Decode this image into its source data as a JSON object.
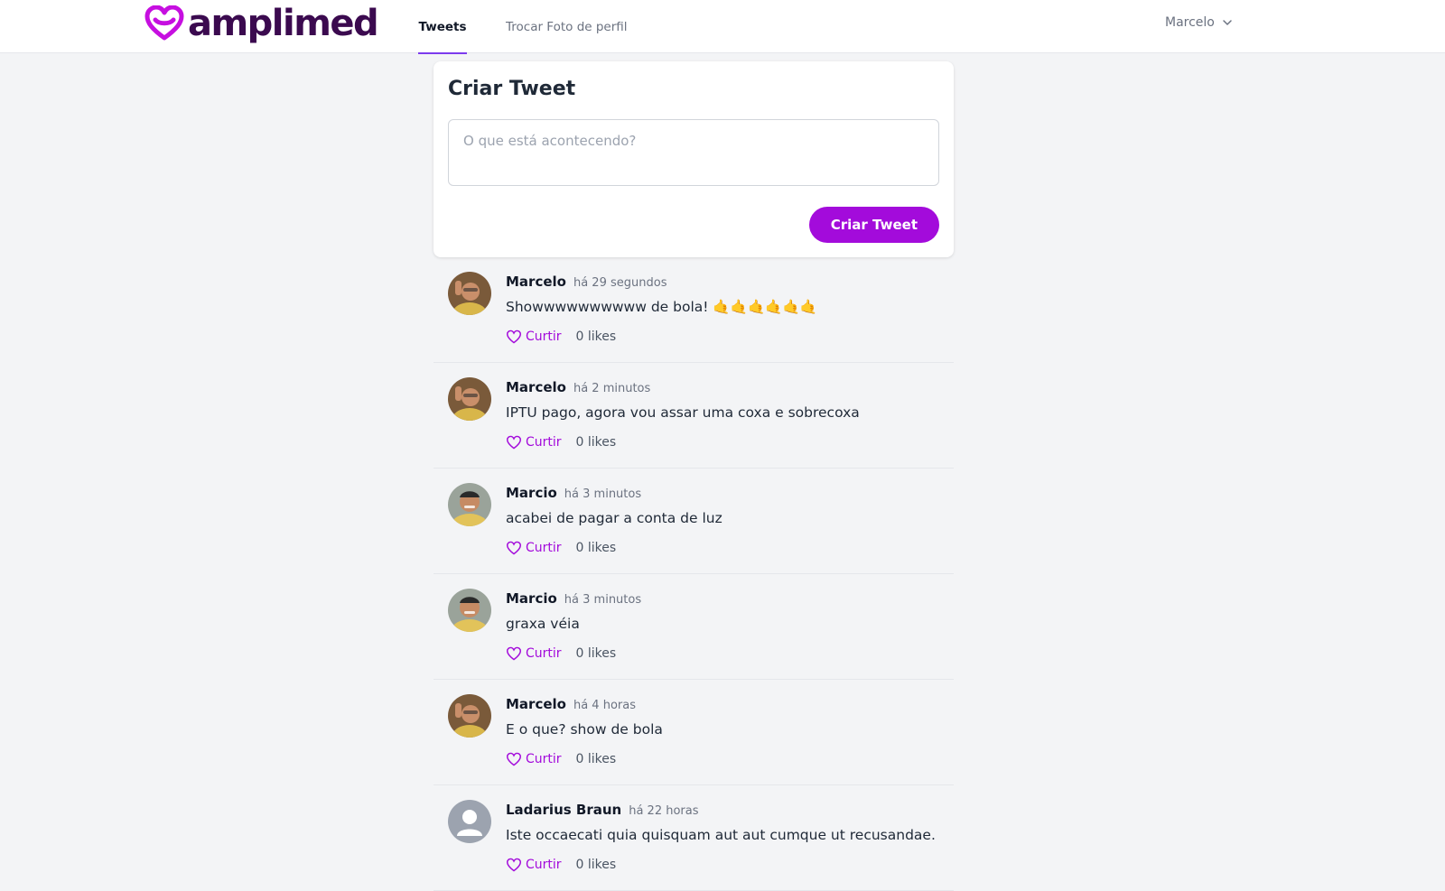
{
  "brand": {
    "name": "amplimed",
    "accent": "#a30bdb",
    "dark": "#3b0a4f"
  },
  "nav": {
    "tabs": [
      {
        "label": "Tweets",
        "active": true
      },
      {
        "label": "Trocar Foto de perfil",
        "active": false
      }
    ],
    "user": {
      "name": "Marcelo",
      "icon": "chevron-down-icon"
    }
  },
  "compose": {
    "title": "Criar Tweet",
    "placeholder": "O que está acontecendo?",
    "value": "",
    "button": "Criar Tweet"
  },
  "tweets": [
    {
      "author": "Marcelo",
      "time": "há 29 segundos",
      "text": "Showwwwwwwwww de bola! 🤙🤙🤙🤙🤙🤙",
      "like_label": "Curtir",
      "likes": "0 likes",
      "avatar": "photo-marcelo"
    },
    {
      "author": "Marcelo",
      "time": "há 2 minutos",
      "text": "IPTU pago, agora vou assar uma coxa e sobrecoxa",
      "like_label": "Curtir",
      "likes": "0 likes",
      "avatar": "photo-marcelo"
    },
    {
      "author": "Marcio",
      "time": "há 3 minutos",
      "text": "acabei de pagar a conta de luz",
      "like_label": "Curtir",
      "likes": "0 likes",
      "avatar": "photo-marcio"
    },
    {
      "author": "Marcio",
      "time": "há 3 minutos",
      "text": "graxa véia",
      "like_label": "Curtir",
      "likes": "0 likes",
      "avatar": "photo-marcio"
    },
    {
      "author": "Marcelo",
      "time": "há 4 horas",
      "text": "E o que? show de bola",
      "like_label": "Curtir",
      "likes": "0 likes",
      "avatar": "photo-marcelo"
    },
    {
      "author": "Ladarius Braun",
      "time": "há 22 horas",
      "text": "Iste occaecati quia quisquam aut aut cumque ut recusandae.",
      "like_label": "Curtir",
      "likes": "0 likes",
      "avatar": "default-user-icon"
    }
  ]
}
